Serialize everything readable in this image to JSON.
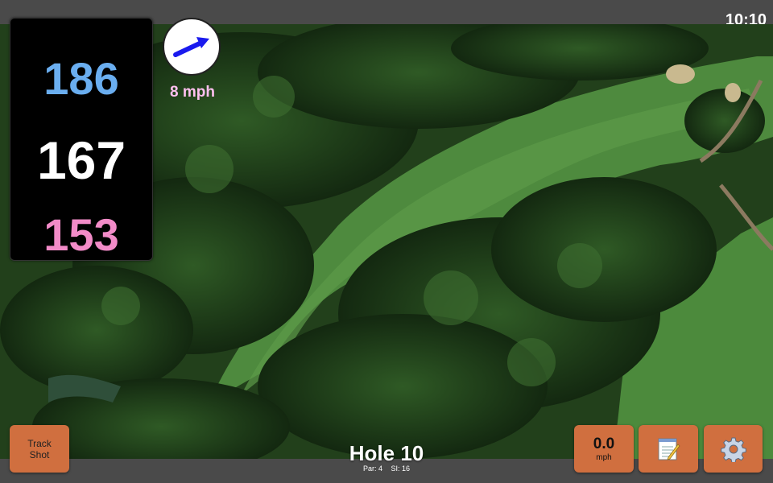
{
  "status": {
    "time": "10:10"
  },
  "distances": {
    "back": "186",
    "middle": "167",
    "front": "153"
  },
  "wind": {
    "speed": "8 mph",
    "icon": "wind-direction-arrow-icon"
  },
  "buttons": {
    "track_shot": "Track\nShot",
    "speed_value": "0.0",
    "speed_unit": "mph",
    "notes_icon": "notepad-icon",
    "settings_icon": "gear-icon"
  },
  "hole": {
    "title": "Hole 10",
    "par": "Par: 4",
    "si": "SI: 16"
  },
  "colors": {
    "back": "#6aaef0",
    "middle": "#ffffff",
    "front": "#f28bc8",
    "wind_text": "#ffc0f0",
    "button": "#d06f3f"
  }
}
